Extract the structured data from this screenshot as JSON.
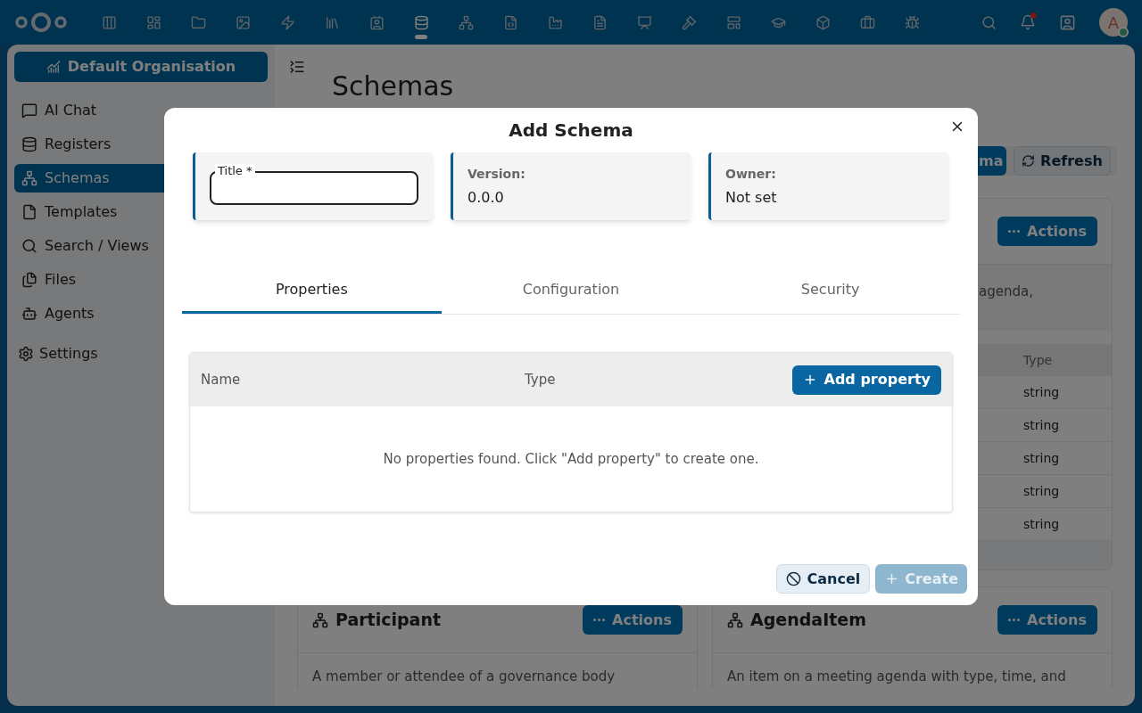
{
  "top_bar": {
    "apps": [
      {
        "selected": false
      },
      {
        "selected": false
      },
      {
        "selected": false
      },
      {
        "selected": false
      },
      {
        "selected": false
      },
      {
        "selected": false
      },
      {
        "selected": false
      },
      {
        "selected": true
      },
      {
        "selected": false
      },
      {
        "selected": false
      },
      {
        "selected": false
      },
      {
        "selected": false
      },
      {
        "selected": false
      },
      {
        "selected": false
      },
      {
        "selected": false
      },
      {
        "selected": false
      },
      {
        "selected": false
      },
      {
        "selected": false
      },
      {
        "selected": false
      }
    ],
    "notifications": {
      "unread": true
    },
    "avatar": {
      "initial": "A",
      "online": true
    }
  },
  "sidebar": {
    "organisation": "Default Organisation",
    "items": [
      {
        "label": "AI Chat",
        "selected": false
      },
      {
        "label": "Registers",
        "selected": false
      },
      {
        "label": "Schemas",
        "selected": true
      },
      {
        "label": "Templates",
        "selected": false
      },
      {
        "label": "Search / Views",
        "selected": false
      },
      {
        "label": "Files",
        "selected": false
      },
      {
        "label": "Agents",
        "selected": false
      }
    ],
    "settings": "Settings"
  },
  "main": {
    "title": "Schemas",
    "toolbar": {
      "add_button": "ma",
      "refresh_button": "Refresh"
    },
    "top_card": {
      "actions": "Actions",
      "description": "agenda,",
      "column": "Type",
      "rows": [
        "string",
        "string",
        "string",
        "string",
        "string"
      ]
    },
    "cards": [
      {
        "title": "Participant",
        "actions": "Actions",
        "description": "A member or attendee of a governance body"
      },
      {
        "title": "AgendaItem",
        "actions": "Actions",
        "description": "An item on a meeting agenda with type, time, and"
      }
    ]
  },
  "modal": {
    "title": "Add Schema",
    "fields": [
      {
        "kind": "input",
        "label": "Title *"
      },
      {
        "kind": "info",
        "label": "Version:",
        "value": "0.0.0"
      },
      {
        "kind": "info",
        "label": "Owner:",
        "value": "Not set"
      }
    ],
    "tabs": [
      {
        "label": "Properties",
        "selected": true
      },
      {
        "label": "Configuration",
        "selected": false
      },
      {
        "label": "Security",
        "selected": false
      }
    ],
    "properties_table": {
      "columns": [
        "Name",
        "Type"
      ],
      "add_button": "Add property",
      "empty_message": "No properties found. Click \"Add property\" to create one."
    },
    "buttons": [
      {
        "kind": "cancel",
        "label": "Cancel",
        "disabled": false
      },
      {
        "kind": "create",
        "label": "Create",
        "disabled": true
      }
    ]
  }
}
